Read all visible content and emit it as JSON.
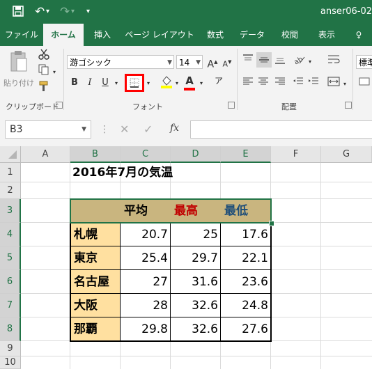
{
  "titlebar": {
    "save_icon": "💾",
    "undo_icon": "↶",
    "undo_arrow": "▾",
    "redo_icon": "↷",
    "redo_arrow": "▾",
    "customize_icon": "▾",
    "filename": "anser06-02"
  },
  "tabs": [
    {
      "label": "ファイル"
    },
    {
      "label": "ホーム"
    },
    {
      "label": "挿入"
    },
    {
      "label": "ページ レイアウト"
    },
    {
      "label": "数式"
    },
    {
      "label": "データ"
    },
    {
      "label": "校閲"
    },
    {
      "label": "表示"
    },
    {
      "label": "♀"
    }
  ],
  "ribbon": {
    "clipboard": {
      "paste_label": "貼り付け",
      "group_label": "クリップボード"
    },
    "font": {
      "font_name": "游ゴシック",
      "font_size": "14",
      "grow": "A",
      "shrink": "A",
      "bold": "B",
      "italic": "I",
      "underline": "U",
      "font_color_letter": "A",
      "phonetic": "ア",
      "group_label": "フォント"
    },
    "alignment": {
      "group_label": "配置"
    },
    "number": {
      "format": "標準"
    }
  },
  "formula_bar": {
    "name_box": "B3",
    "cancel": "✕",
    "enter": "✓",
    "fx": "fx",
    "dots": "⋮",
    "formula": ""
  },
  "sheet": {
    "columns": [
      "A",
      "B",
      "C",
      "D",
      "E",
      "F",
      "G"
    ],
    "rows": [
      "1",
      "2",
      "3",
      "4",
      "5",
      "6",
      "7",
      "8",
      "9",
      "10"
    ],
    "title": "2016年7月の気温",
    "header": [
      "",
      "平均",
      "最高",
      "最低"
    ],
    "data": [
      {
        "city": "札幌",
        "avg": "20.7",
        "max": "25",
        "min": "17.6"
      },
      {
        "city": "東京",
        "avg": "25.4",
        "max": "29.7",
        "min": "22.1"
      },
      {
        "city": "名古屋",
        "avg": "27",
        "max": "31.6",
        "min": "23.6"
      },
      {
        "city": "大阪",
        "avg": "28",
        "max": "32.6",
        "min": "24.8"
      },
      {
        "city": "那覇",
        "avg": "29.8",
        "max": "32.6",
        "min": "27.6"
      }
    ]
  },
  "colors": {
    "accent": "#217346",
    "header_fill": "#c9b57f",
    "city_fill": "#ffe0a0",
    "max_text": "#c00000",
    "min_text": "#1f4e79",
    "highlight": "#ff0000"
  }
}
